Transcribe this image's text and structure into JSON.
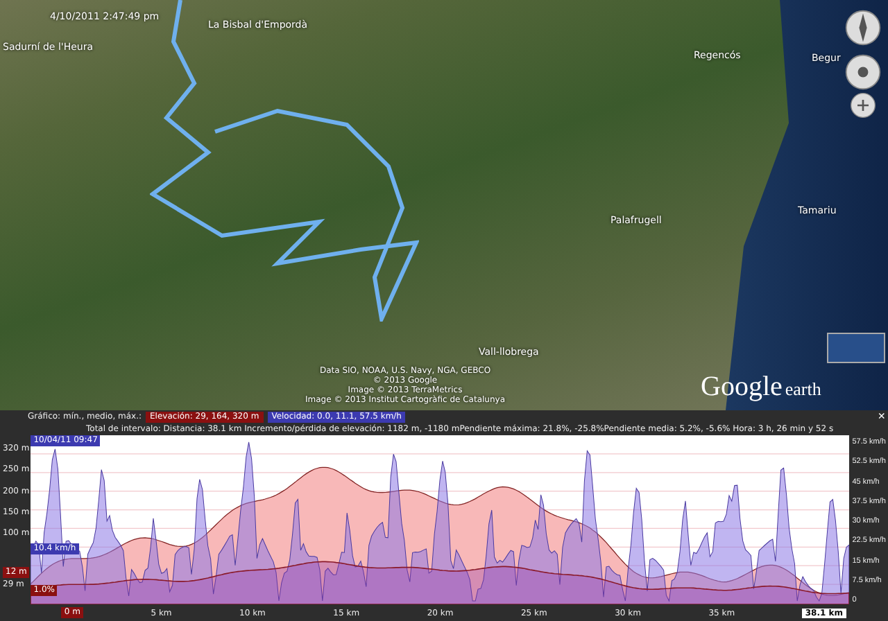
{
  "map": {
    "timestamp": "4/10/2011   2:47:49 pm",
    "labels": [
      "La Bisbal d'Empordà",
      "Sadurní de l'Heura",
      "Regencós",
      "Begur",
      "Palafrugell",
      "Tamariu",
      "Vall-llobrega"
    ],
    "attribution": [
      "Data SIO, NOAA, U.S. Navy, NGA, GEBCO",
      "© 2013 Google",
      "Image © 2013 TerraMetrics",
      "Image © 2013 Institut Cartogràfic de Catalunya"
    ],
    "logo": "Google",
    "logo_suffix": "earth"
  },
  "profile": {
    "summary_label": "Gráfico: mín., medio, máx.:",
    "elevation_badge": "Elevación: 29, 164, 320 m",
    "speed_badge": "Velocidad: 0.0, 11.1, 57.5 km/h",
    "close": "×",
    "interval": "Total de intervalo:  Distancia: 38.1 km    Incremento/pérdida de elevación: 1182 m, -1180 mPendiente máxima: 21.8%, -25.8%Pendiente media: 5.2%, -5.6%    Hora: 3 h, 26 min y 52 s",
    "cursor_time": "10/04/11 09:47",
    "speed_reading": "10.4 km/h",
    "elevation_reading": "12 m",
    "min_marker": "29 m",
    "slope_reading": "1.0%",
    "start_label": "0 m",
    "left_ticks": [
      "320 m",
      "250 m",
      "200 m",
      "150 m",
      "100 m"
    ],
    "right_ticks": [
      "57.5 km/h",
      "52.5 km/h",
      "45 km/h",
      "37.5 km/h",
      "30 km/h",
      "22.5 km/h",
      "15 km/h",
      "7.5 km/h",
      "0"
    ],
    "x_ticks": [
      "5 km",
      "10 km",
      "15 km",
      "20 km",
      "25 km",
      "30 km",
      "35 km",
      "38.1 km"
    ]
  }
}
